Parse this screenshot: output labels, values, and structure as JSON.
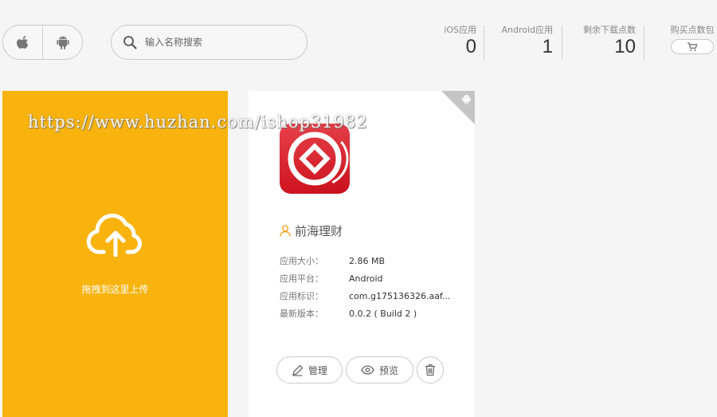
{
  "platform_filter": {
    "options": [
      {
        "name": "ios",
        "icon": "apple-icon"
      },
      {
        "name": "android",
        "icon": "android-icon"
      }
    ]
  },
  "search": {
    "placeholder": "输入名称搜索",
    "value": "",
    "icon": "search-icon"
  },
  "stats": {
    "ios_label": "iOS应用",
    "ios_value": "0",
    "android_label": "Android应用",
    "android_value": "1",
    "downloads_label": "剩余下载点数",
    "downloads_value": "10",
    "buy_label": "购买点数包",
    "buy_icon": "cart-icon"
  },
  "upload": {
    "label": "拖拽到这里上传",
    "icon": "cloud-upload-icon",
    "color": "#f8b30e"
  },
  "app_card": {
    "platform_badge_icon": "android-icon",
    "name": "前海理财",
    "name_icon": "user-icon",
    "icon_color": "#d61a24",
    "info": [
      {
        "label": "应用大小：",
        "value": "2.86 MB"
      },
      {
        "label": "应用平台：",
        "value": "Android"
      },
      {
        "label": "应用标识：",
        "value": "com.g175136326.aaf..."
      },
      {
        "label": "最新版本：",
        "value": "0.0.2 ( Build 2 )"
      }
    ],
    "actions": {
      "manage_label": "管理",
      "manage_icon": "pencil-icon",
      "preview_label": "预览",
      "preview_icon": "eye-icon",
      "delete_icon": "trash-icon"
    }
  },
  "watermark": "https://www.huzhan.com/ishop31982"
}
